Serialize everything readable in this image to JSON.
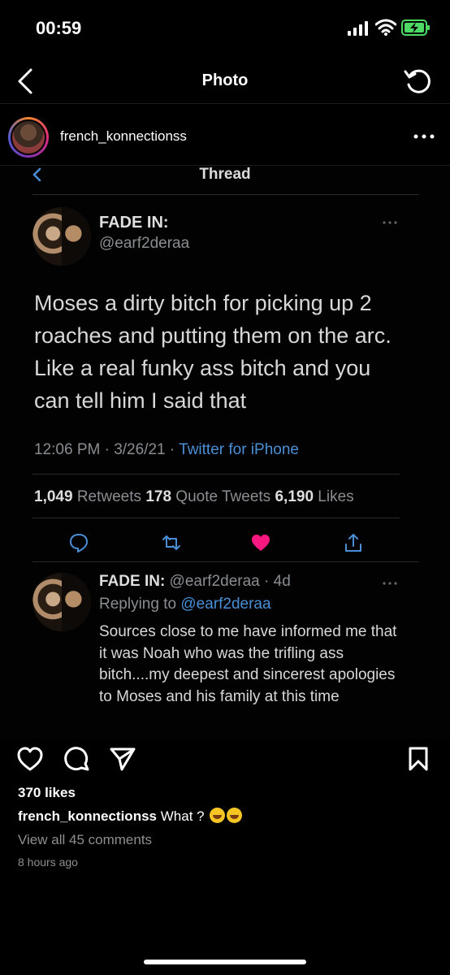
{
  "status_bar": {
    "time": "00:59"
  },
  "nav": {
    "title": "Photo"
  },
  "post": {
    "username": "french_konnectionss",
    "likes": "370 likes",
    "caption_user": "french_konnectionss",
    "caption_text": "What ?",
    "view_comments": "View all 45 comments",
    "timestamp": "8 hours ago"
  },
  "tweet": {
    "thread_title": "Thread",
    "name": "FADE IN:",
    "handle": "@earf2deraa",
    "body": "Moses a dirty bitch for picking up 2 roaches and putting them on the arc. Like a real funky ass bitch and you can tell him I said that",
    "time": "12:06 PM · 3/26/21 · ",
    "source": "Twitter for iPhone",
    "retweets_count": "1,049",
    "retweets_label": " Retweets ",
    "quotes_count": "178",
    "quotes_label": " Quote Tweets ",
    "likes_count": "6,190",
    "likes_label": " Likes"
  },
  "reply": {
    "name": "FADE IN:",
    "handle_age": " @earf2deraa · 4d",
    "replying_prefix": "Replying to ",
    "replying_mention": "@earf2deraa",
    "body": "Sources close to me have informed me that it was Noah who was the trifling ass bitch....my deepest and sincerest apologies to Moses and his family at this time"
  },
  "colors": {
    "twitter_blue": "#4a8fd6",
    "like_red": "#f91880",
    "battery_green": "#4cd964"
  }
}
